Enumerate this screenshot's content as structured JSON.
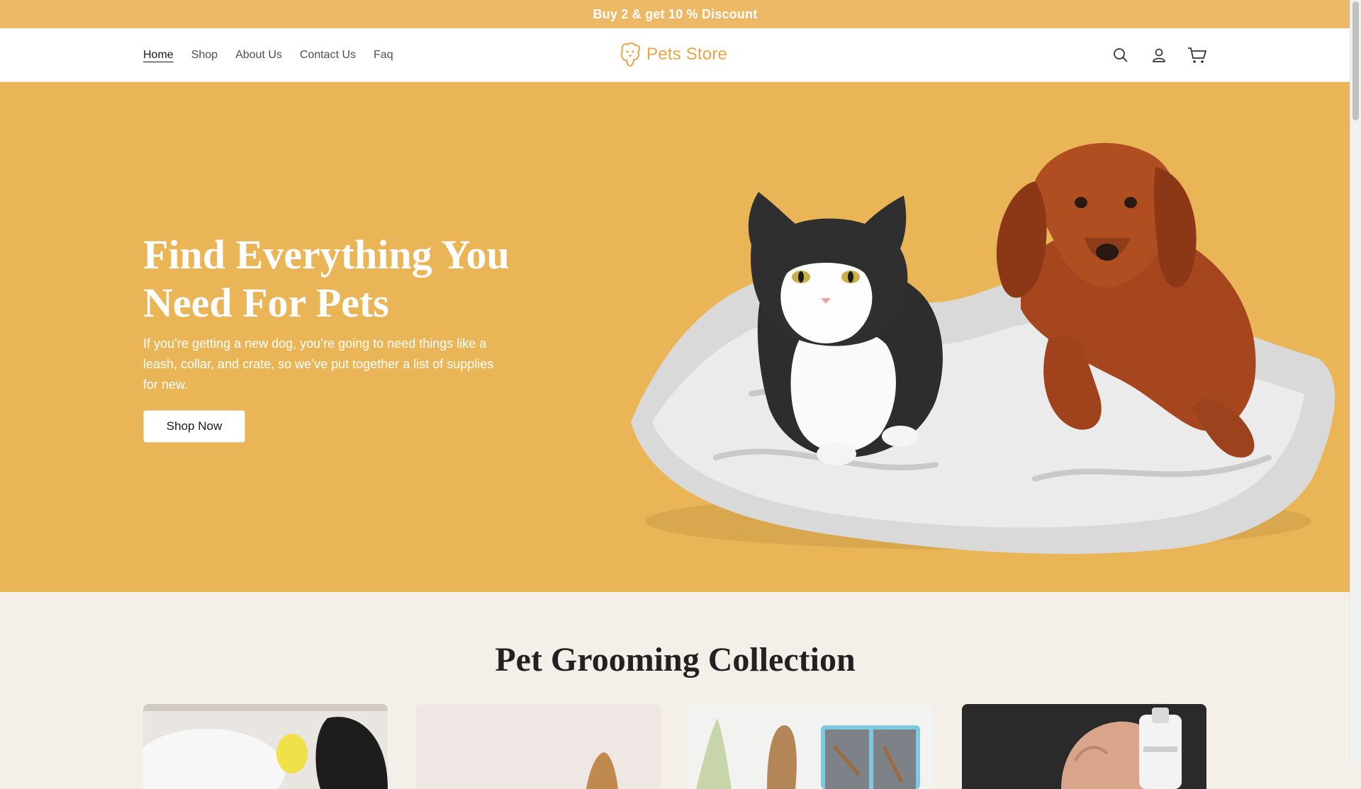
{
  "announcement": {
    "text": "Buy 2 & get 10 % Discount"
  },
  "nav": {
    "items": [
      {
        "label": "Home",
        "active": true
      },
      {
        "label": "Shop",
        "active": false
      },
      {
        "label": "About Us",
        "active": false
      },
      {
        "label": "Contact Us",
        "active": false
      },
      {
        "label": "Faq",
        "active": false
      }
    ]
  },
  "logo": {
    "text": "Pets Store",
    "icon": "pet-paw-logo-icon"
  },
  "header_icons": [
    "search-icon",
    "account-icon",
    "cart-icon"
  ],
  "hero": {
    "title": "Find Everything You Need For Pets",
    "description": "If you’re getting a new dog, you’re going to need things like a leash, collar, and crate, so we’ve put together a list of supplies for new.",
    "button": "Shop Now"
  },
  "collection": {
    "title": "Pet Grooming Collection",
    "cards": [
      "grooming-card-bath",
      "grooming-card-brush",
      "grooming-card-comb",
      "grooming-card-nail-grinder"
    ]
  },
  "colors": {
    "announcement_bg": "#edb967",
    "hero_bg": "#e9b557",
    "logo_accent": "#e9a54a",
    "section_bg": "#f4efe9"
  }
}
